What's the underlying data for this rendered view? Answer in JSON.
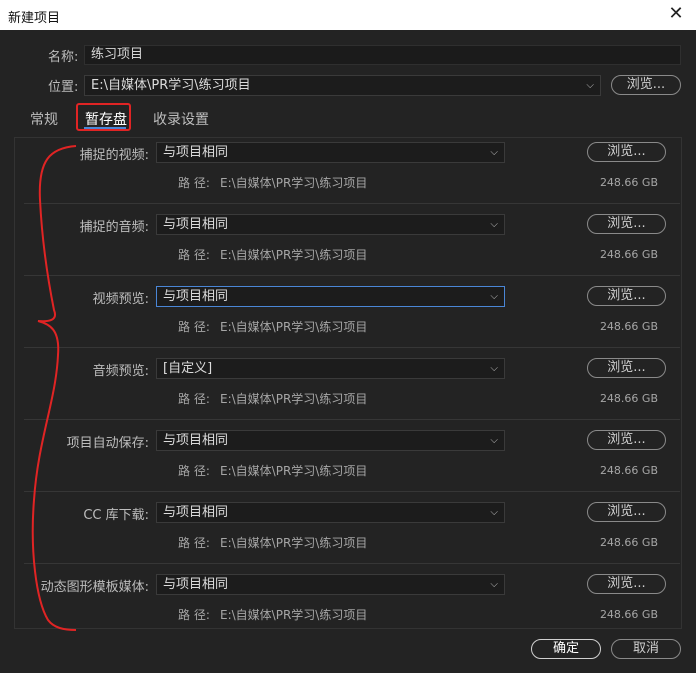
{
  "window": {
    "title": "新建项目"
  },
  "name": {
    "label": "名称:",
    "value": "练习项目"
  },
  "location": {
    "label": "位置:",
    "value": "E:\\自媒体\\PR学习\\练习项目",
    "browse": "浏览..."
  },
  "tabs": [
    {
      "label": "常规",
      "active": false
    },
    {
      "label": "暂存盘",
      "active": true
    },
    {
      "label": "收录设置",
      "active": false
    }
  ],
  "rows": [
    {
      "label": "捕捉的视频:",
      "value": "与项目相同",
      "path_label": "路 径:",
      "path": "E:\\自媒体\\PR学习\\练习项目",
      "size": "248.66 GB",
      "browse": "浏览..."
    },
    {
      "label": "捕捉的音频:",
      "value": "与项目相同",
      "path_label": "路 径:",
      "path": "E:\\自媒体\\PR学习\\练习项目",
      "size": "248.66 GB",
      "browse": "浏览..."
    },
    {
      "label": "视频预览:",
      "value": "与项目相同",
      "path_label": "路 径:",
      "path": "E:\\自媒体\\PR学习\\练习项目",
      "size": "248.66 GB",
      "browse": "浏览..."
    },
    {
      "label": "音频预览:",
      "value": "[自定义]",
      "path_label": "路 径:",
      "path": "E:\\自媒体\\PR学习\\练习项目",
      "size": "248.66 GB",
      "browse": "浏览..."
    },
    {
      "label": "项目自动保存:",
      "value": "与项目相同",
      "path_label": "路 径:",
      "path": "E:\\自媒体\\PR学习\\练习项目",
      "size": "248.66 GB",
      "browse": "浏览..."
    },
    {
      "label": "CC 库下载:",
      "value": "与项目相同",
      "path_label": "路 径:",
      "path": "E:\\自媒体\\PR学习\\练习项目",
      "size": "248.66 GB",
      "browse": "浏览..."
    },
    {
      "label": "动态图形模板媒体:",
      "value": "与项目相同",
      "path_label": "路 径:",
      "path": "E:\\自媒体\\PR学习\\练习项目",
      "size": "248.66 GB",
      "browse": "浏览..."
    }
  ],
  "footer": {
    "ok": "确定",
    "cancel": "取消"
  },
  "colors": {
    "accent": "#4a86d6",
    "annotation": "#e02424",
    "background": "#232323"
  },
  "icons": {
    "close": "close-icon",
    "dropdown": "chevron-down-icon"
  }
}
